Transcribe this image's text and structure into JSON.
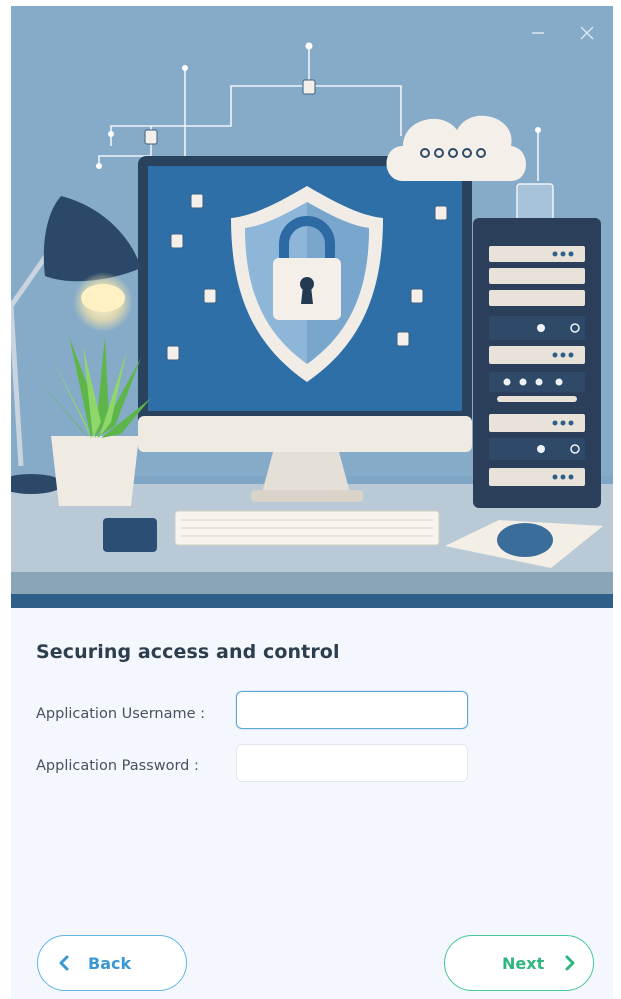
{
  "window": {
    "controls": {
      "minimize_icon": "minimize-icon",
      "close_icon": "close-icon"
    }
  },
  "hero": {
    "description_icons": [
      "shield-lock-icon",
      "cloud-icon",
      "server-rack-icon",
      "desk-lamp-icon",
      "plant-icon",
      "monitor-icon",
      "keyboard-icon",
      "mouse-icon"
    ]
  },
  "form": {
    "title": "Securing access and control",
    "username": {
      "label": "Application Username :",
      "value": ""
    },
    "password": {
      "label": "Application Password :",
      "value": ""
    }
  },
  "footer": {
    "back_label": "Back",
    "next_label": "Next"
  },
  "colors": {
    "accent_blue": "#3a97d2",
    "accent_green": "#2fb57e",
    "panel_bg": "#f4f7fd",
    "title_text": "#2c3e4e"
  }
}
